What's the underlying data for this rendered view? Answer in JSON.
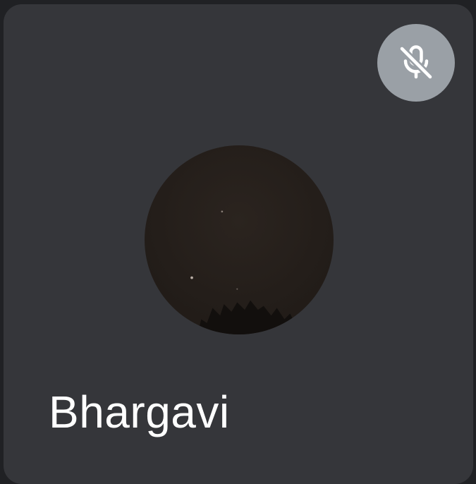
{
  "participant": {
    "name": "Bhargavi",
    "mic_status_icon": "mic-off-icon",
    "avatar_icon": "night-sky-photo"
  },
  "colors": {
    "tile_background": "#35363a",
    "page_background": "#202124",
    "mute_badge": "#9aa0a6",
    "name_text": "#ffffff"
  }
}
